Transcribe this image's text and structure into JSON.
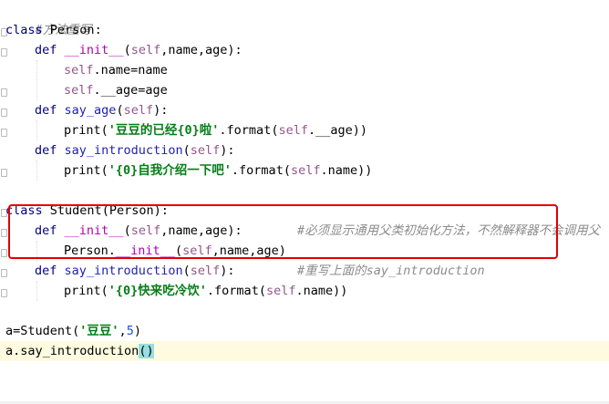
{
  "editor": {
    "lines": [
      {
        "id": 1,
        "kind": "comment",
        "text": "#方法重写"
      },
      {
        "id": 2,
        "kw": "class",
        "name": "Person",
        "rest": ":"
      },
      {
        "id": 3,
        "def": "def",
        "fn": "__init__",
        "p_open": "(",
        "self": "self",
        "rest": ",name,age):"
      },
      {
        "id": 4,
        "self": "self",
        "rest": ".name=name"
      },
      {
        "id": 5,
        "self": "self",
        "rest": ".__age=age"
      },
      {
        "id": 6,
        "def": "def",
        "fn": "say_age",
        "p_open": "(",
        "self": "self",
        "rest": "):"
      },
      {
        "id": 7,
        "call": "print(",
        "str": "'豆豆的已经{0}啦'",
        "mid": ".format(",
        "self": "self",
        "rest": ".__age))"
      },
      {
        "id": 8,
        "def": "def",
        "fn": "say_introduction",
        "p_open": "(",
        "self": "self",
        "rest": "):"
      },
      {
        "id": 9,
        "call": "print(",
        "str": "'{0}自我介绍一下吧'",
        "mid": ".format(",
        "self": "self",
        "rest": ".name))"
      },
      {
        "id": 10,
        "kw": "class",
        "name": "Student",
        "rest": "(Person):"
      },
      {
        "id": 11,
        "def": "def",
        "fn": "__init__",
        "p_open": "(",
        "self": "self",
        "rest": ",name,age):",
        "comment": "#必须显示通用父类初始化方法，不然解释器不会调用父"
      },
      {
        "id": 12,
        "call": "Person.",
        "fn": "__init__",
        "p_open": "(",
        "self": "self",
        "rest": ",name,age)"
      },
      {
        "id": 13,
        "def": "def",
        "fn": "say_introduction",
        "p_open": "(",
        "self": "self",
        "rest": "):",
        "comment": "#重写上面的say_introduction"
      },
      {
        "id": 14,
        "call": "print(",
        "str": "'{0}快来吃冷饮'",
        "mid": ".format(",
        "self": "self",
        "rest": ".name))"
      },
      {
        "id": 15,
        "call": "a=Student(",
        "str": "'豆豆'",
        "mid": ",",
        "num": "5",
        "rest": ")"
      },
      {
        "id": 16,
        "call": "a.say_introduction",
        "caret": "()"
      }
    ]
  }
}
